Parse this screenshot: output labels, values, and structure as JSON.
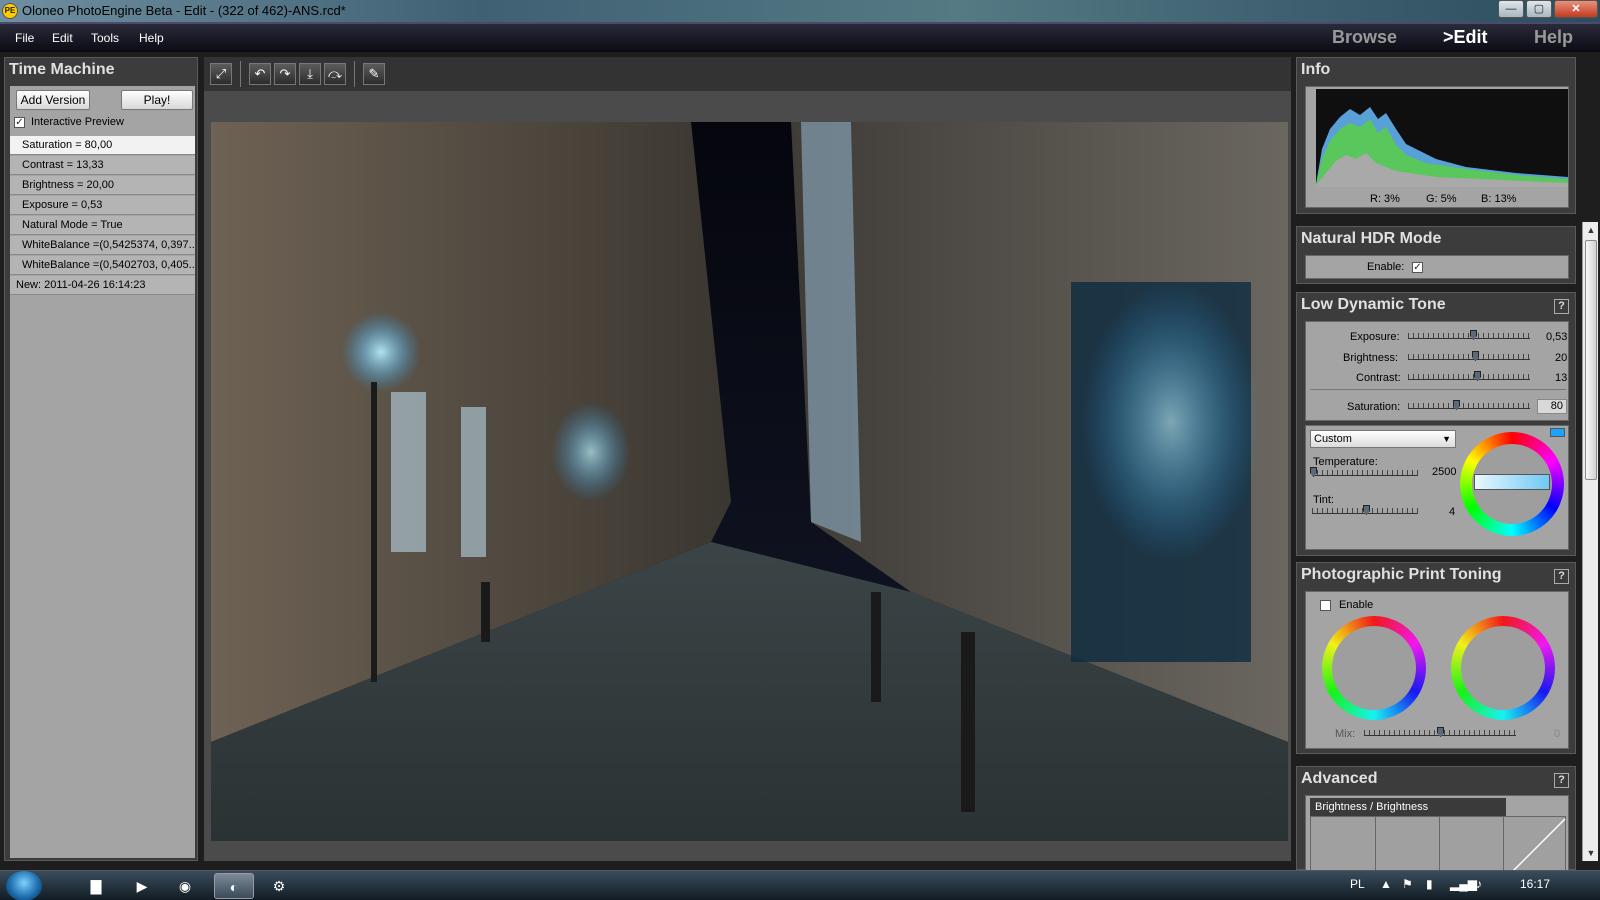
{
  "window": {
    "title": "Oloneo PhotoEngine Beta - Edit -  (322 of 462)-ANS.rcd*",
    "app_icon": "PE"
  },
  "window_controls": {
    "minimize": "—",
    "maximize": "▢",
    "close": "✕"
  },
  "menu": [
    "File",
    "Edit",
    "Tools",
    "Help"
  ],
  "modes": {
    "browse": "Browse",
    "edit": ">Edit",
    "help": "Help"
  },
  "time_machine": {
    "title": "Time Machine",
    "add_version": "Add Version",
    "play": "Play!",
    "interactive_preview": "Interactive Preview",
    "history": [
      "Saturation = 80,00",
      "Contrast = 13,33",
      "Brightness = 20,00",
      "Exposure = 0,53",
      "Natural Mode = True",
      "WhiteBalance =(0,5425374, 0,397...",
      "WhiteBalance =(0,5402703, 0,405...",
      "New: 2011-04-26 16:14:23"
    ]
  },
  "toolbar_icons": [
    "⤢",
    "↶",
    "↷",
    "⤓",
    "⤼",
    "✎"
  ],
  "info": {
    "title": "Info",
    "r": "R: 3%",
    "g": "G: 5%",
    "b": "B: 13%"
  },
  "natural_hdr": {
    "title": "Natural HDR Mode",
    "enable_label": "Enable:",
    "check": "✓"
  },
  "low_dynamic_tone": {
    "title": "Low Dynamic Tone",
    "help": "?",
    "sliders": [
      {
        "label": "Exposure:",
        "value": "0,53"
      },
      {
        "label": "Brightness:",
        "value": "20"
      },
      {
        "label": "Contrast:",
        "value": "13"
      },
      {
        "label": "Saturation:",
        "value": "80"
      }
    ],
    "wb_preset": "Custom",
    "temperature_label": "Temperature:",
    "temperature_value": "2500",
    "tint_label": "Tint:",
    "tint_value": "4"
  },
  "print_toning": {
    "title": "Photographic Print Toning",
    "help": "?",
    "enable_label": "Enable",
    "mix_label": "Mix:",
    "mix_value": "0"
  },
  "advanced": {
    "title": "Advanced",
    "help": "?",
    "curve_label": "Brightness / Brightness"
  },
  "taskbar": {
    "lang": "PL",
    "time": "16:17"
  },
  "colors": {
    "accent_blue": "#1aa3ff",
    "panel_bg": "#3c3c3c",
    "inner_bg": "#a4a4a4"
  }
}
